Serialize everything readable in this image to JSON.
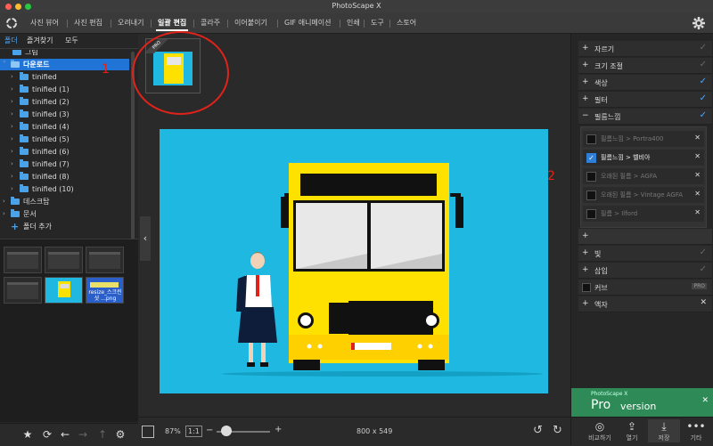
{
  "window": {
    "title": "PhotoScape X"
  },
  "colors": {
    "accent": "#1f74d6",
    "annotation": "#e0231a",
    "canvas_bg": "#1eb8e0",
    "bus_yellow": "#ffe100"
  },
  "menu": {
    "items": [
      "사진 뷰어",
      "사진 편집",
      "오려내기",
      "일괄 편집",
      "콜라주",
      "이어붙이기",
      "GIF 애니메이션",
      "인쇄",
      "도구",
      "스토어"
    ],
    "active": "일괄 편집"
  },
  "left": {
    "tabs": [
      "폴더",
      "즐겨찾기",
      "모두"
    ],
    "tree": [
      {
        "label": "그림",
        "level": 1,
        "partial": true
      },
      {
        "label": "다운로드",
        "level": 0,
        "selected": true
      },
      {
        "label": "tinified",
        "level": 1
      },
      {
        "label": "tinified (1)",
        "level": 1
      },
      {
        "label": "tinified (2)",
        "level": 1
      },
      {
        "label": "tinified (3)",
        "level": 1
      },
      {
        "label": "tinified (4)",
        "level": 1
      },
      {
        "label": "tinified (5)",
        "level": 1
      },
      {
        "label": "tinified (6)",
        "level": 1
      },
      {
        "label": "tinified (7)",
        "level": 1
      },
      {
        "label": "tinified (8)",
        "level": 1
      },
      {
        "label": "tinified (10)",
        "level": 1
      },
      {
        "label": "데스크탑",
        "level": 0
      },
      {
        "label": "문서",
        "level": 0
      },
      {
        "label": "폴더 추가",
        "level": 0,
        "add": true
      }
    ],
    "thumb_caption": "resize_스크린샷 ...png"
  },
  "center": {
    "zoom": "87%",
    "ratio": "1:1",
    "dimensions": "800 x 549",
    "pro_badge": "PRO"
  },
  "annotations": {
    "one": "1",
    "two": "2"
  },
  "right": {
    "sections": [
      {
        "label": "자르기",
        "checked": false
      },
      {
        "label": "크기 조절",
        "checked": false
      },
      {
        "label": "색상",
        "checked": true
      },
      {
        "label": "필터",
        "checked": true
      },
      {
        "label": "필름느낌",
        "checked": true,
        "expanded": true
      }
    ],
    "film_items": [
      {
        "label": "필름느낌 > Portra400",
        "on": false
      },
      {
        "label": "필름느낌 > 벨비아",
        "on": true
      },
      {
        "label": "오래된 필름 > AGFA",
        "on": false
      },
      {
        "label": "오래된 필름 > Vintage AGFA",
        "on": false
      },
      {
        "label": "필름 > Ilford",
        "on": false
      }
    ],
    "more_sections": [
      {
        "label": "빛",
        "sign": "+"
      },
      {
        "label": "삽입",
        "sign": "+"
      },
      {
        "label": "커브",
        "sign": "",
        "pro": "PRO"
      },
      {
        "label": "액자",
        "sign": "+",
        "close": true
      }
    ],
    "pro_ad": {
      "small": "PhotoScape X",
      "big": "Pro",
      "rest": "version"
    },
    "bottom": [
      "비교하기",
      "열기",
      "저장",
      "기타"
    ]
  }
}
